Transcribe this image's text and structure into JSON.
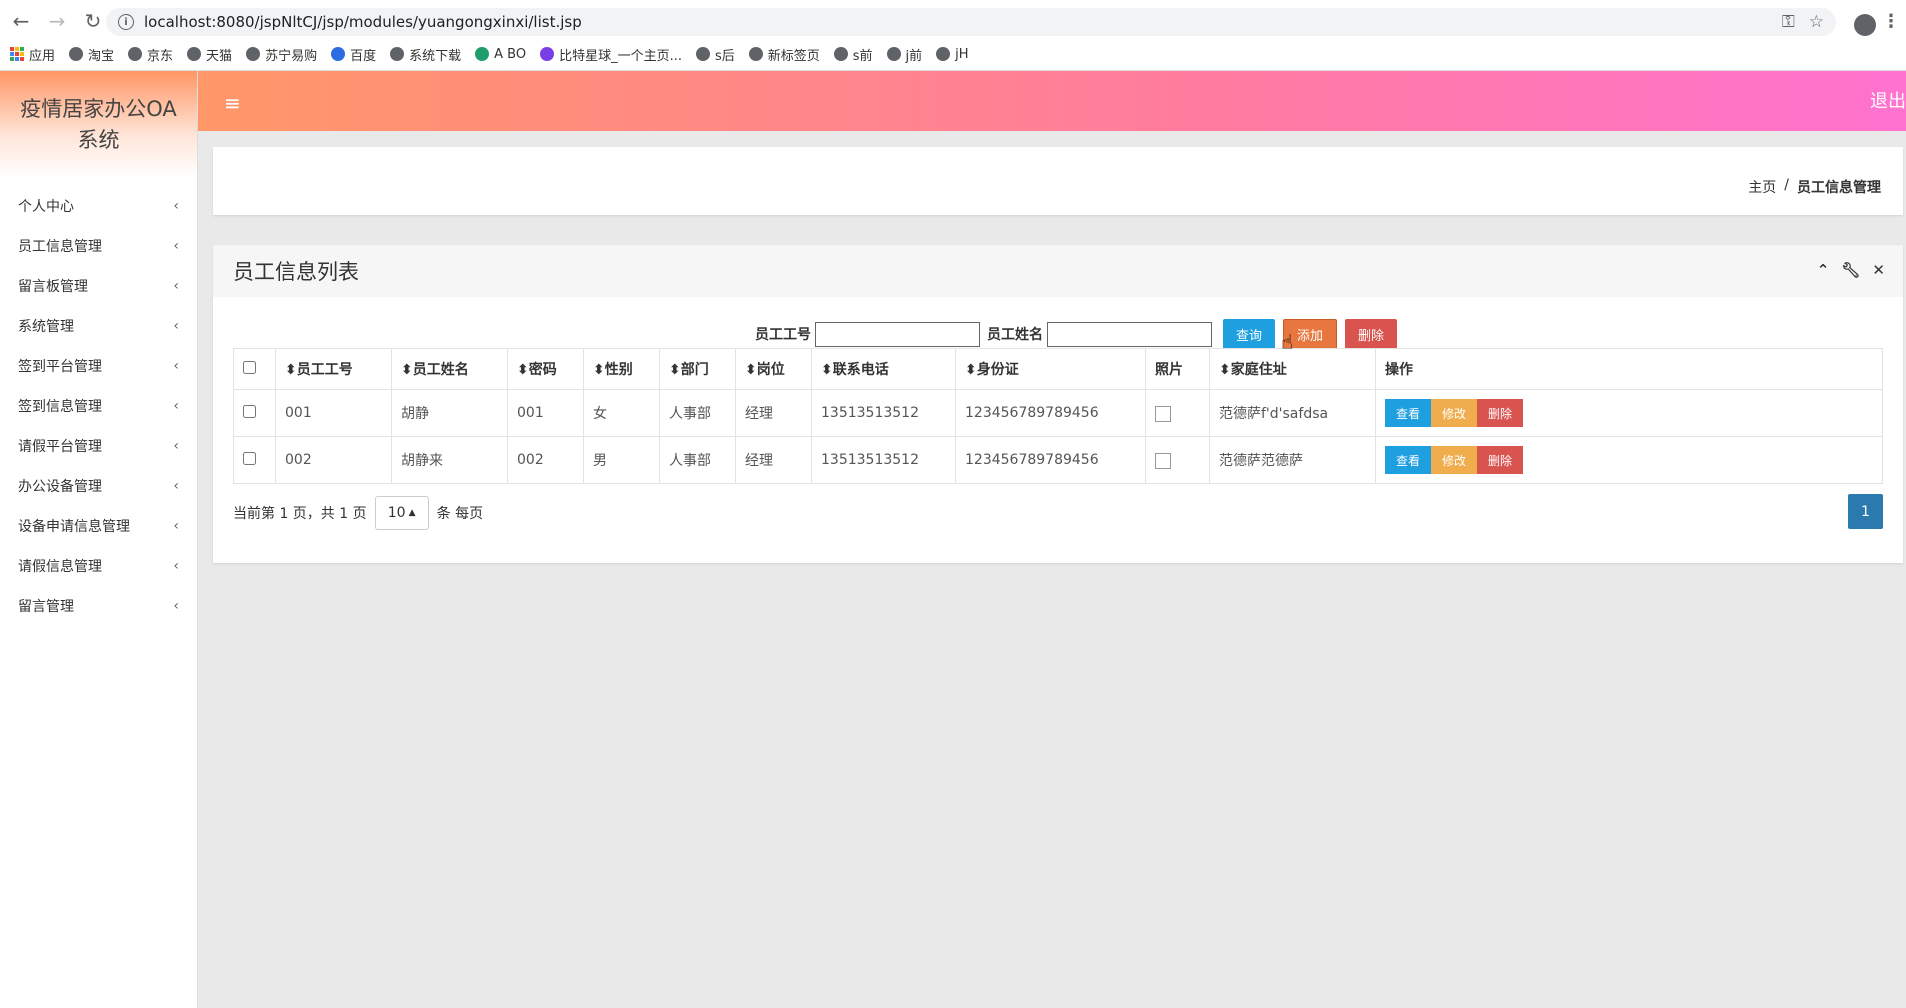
{
  "browser": {
    "url": "localhost:8080/jspNltCJ/jsp/modules/yuangongxinxi/list.jsp",
    "bookmarks": [
      {
        "label": "应用",
        "icon": "apps-icon"
      },
      {
        "label": "淘宝",
        "icon": "globe-icon"
      },
      {
        "label": "京东",
        "icon": "globe-icon"
      },
      {
        "label": "天猫",
        "icon": "globe-icon"
      },
      {
        "label": "苏宁易购",
        "icon": "globe-icon"
      },
      {
        "label": "百度",
        "icon": "paw-icon"
      },
      {
        "label": "系统下载",
        "icon": "globe-icon"
      },
      {
        "label": "A BO",
        "icon": "leaf-icon"
      },
      {
        "label": "比特星球_一个主页...",
        "icon": "planet-icon"
      },
      {
        "label": "s后",
        "icon": "globe-icon"
      },
      {
        "label": "新标签页",
        "icon": "globe-icon"
      },
      {
        "label": "s前",
        "icon": "globe-icon"
      },
      {
        "label": "j前",
        "icon": "globe-icon"
      },
      {
        "label": "jH",
        "icon": "globe-icon"
      }
    ]
  },
  "app": {
    "brand": "疫情居家办公OA系统",
    "logout": "退出",
    "colors": {
      "topbar_start": "#ff9768",
      "topbar_end": "#ff72cf",
      "primary": "#1e9fe0",
      "danger": "#d9534f",
      "warning": "#f0ad4e",
      "page_active": "#2a7ab0"
    }
  },
  "sidebar": {
    "items": [
      {
        "label": "个人中心"
      },
      {
        "label": "员工信息管理"
      },
      {
        "label": "留言板管理"
      },
      {
        "label": "系统管理"
      },
      {
        "label": "签到平台管理"
      },
      {
        "label": "签到信息管理"
      },
      {
        "label": "请假平台管理"
      },
      {
        "label": "办公设备管理"
      },
      {
        "label": "设备申请信息管理"
      },
      {
        "label": "请假信息管理"
      },
      {
        "label": "留言管理"
      }
    ]
  },
  "breadcrumb": {
    "home": "主页",
    "separator": "/",
    "current": "员工信息管理"
  },
  "list": {
    "title": "员工信息列表",
    "search": {
      "employee_no_label": "员工工号",
      "employee_no_value": "",
      "employee_name_label": "员工姓名",
      "employee_name_value": "",
      "query_label": "查询",
      "add_label": "添加",
      "delete_label": "删除"
    },
    "columns": [
      "员工工号",
      "员工姓名",
      "密码",
      "性别",
      "部门",
      "岗位",
      "联系电话",
      "身份证",
      "照片",
      "家庭住址",
      "操作"
    ],
    "sort_glyph": "⬍",
    "rows": [
      {
        "no": "001",
        "name": "胡静",
        "password": "001",
        "gender": "女",
        "dept": "人事部",
        "post": "经理",
        "phone": "13513513512",
        "id_card": "123456789789456",
        "address": "范德萨f'd'safdsa"
      },
      {
        "no": "002",
        "name": "胡静来",
        "password": "002",
        "gender": "男",
        "dept": "人事部",
        "post": "经理",
        "phone": "13513513512",
        "id_card": "123456789789456",
        "address": "范德萨范德萨"
      }
    ],
    "row_actions": {
      "view": "查看",
      "edit": "修改",
      "delete": "删除"
    },
    "pager": {
      "info": "当前第 1 页，共 1 页",
      "page_size": "10",
      "per_page_suffix": "条 每页",
      "current_page": "1"
    }
  }
}
